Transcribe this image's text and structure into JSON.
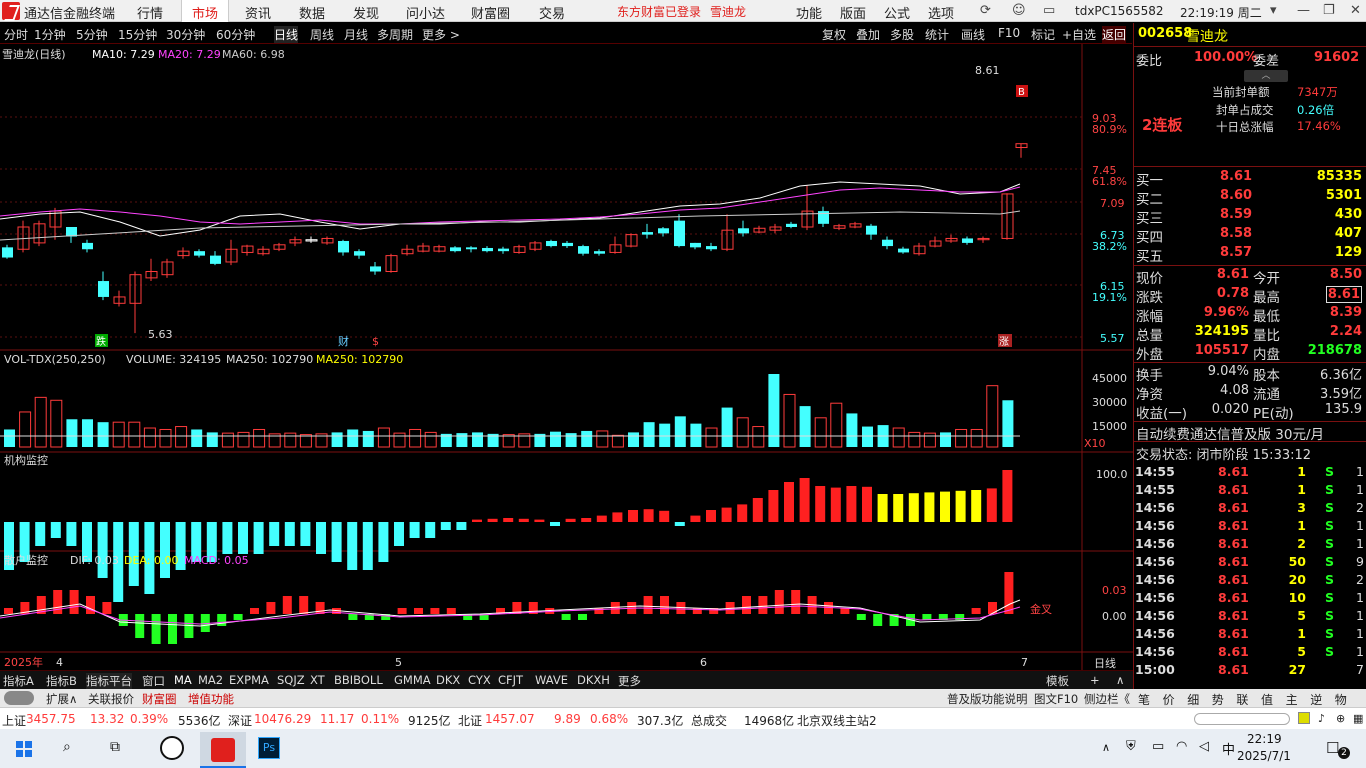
{
  "app": {
    "title": "通达信金融终端"
  },
  "menu": [
    "行情",
    "市场",
    "资讯",
    "数据",
    "发现",
    "问小达",
    "财富圈",
    "交易"
  ],
  "menu_active": 1,
  "login": [
    "东方财富已登录",
    "雪迪龙"
  ],
  "menu_right": [
    "功能",
    "版面",
    "公式",
    "选项"
  ],
  "account": "tdxPC1565582",
  "clock": "22:19:19 周二",
  "periods": [
    "分时",
    "1分钟",
    "5分钟",
    "15分钟",
    "30分钟",
    "60分钟",
    "日线",
    "周线",
    "月线",
    "多周期",
    "更多 >"
  ],
  "period_selected": 6,
  "chart_tools": [
    "复权",
    "叠加",
    "多股",
    "统计",
    "画线",
    "F10",
    "标记",
    "+自选",
    "返回"
  ],
  "kline": {
    "title": "雪迪龙(日线)",
    "ma": [
      {
        "label": "MA10: 7.29",
        "color": "#ffffff"
      },
      {
        "label": "MA20: 7.29",
        "color": "#ff44ff"
      },
      {
        "label": "MA60: 6.98",
        "color": "#dddddd"
      }
    ],
    "price_ticks": [
      "9.03",
      "7.45",
      "7.09",
      "6.73",
      "6.15",
      "5.57"
    ],
    "pct_ticks": [
      "80.9%",
      "61.8%",
      "38.2%",
      "19.1%"
    ],
    "high_label": "8.61",
    "low_label": "5.63",
    "marks": [
      "跌",
      "财",
      "$",
      "涨",
      "B"
    ]
  },
  "volume": {
    "title": "VOL-TDX(250,250)",
    "vol": "VOLUME: 324195",
    "ma": "MA250: 102790",
    "ma2": "MA250: 102790",
    "ticks": [
      "45000",
      "30000",
      "15000"
    ],
    "unit": "X10"
  },
  "inst": {
    "title": "机构监控",
    "ticks": [
      "100.0"
    ]
  },
  "retail": {
    "title": "散户监控",
    "dif": "DIF: 0.03",
    "dea": "DEA: 0.00",
    "macd": "MACD: 0.05",
    "ticks": [
      "0.03",
      "0.00"
    ],
    "cross_label": "金叉"
  },
  "xaxis": {
    "year": "2025年",
    "months": [
      "4",
      "5",
      "6",
      "7"
    ],
    "mode": "日线"
  },
  "chart_data": [
    {
      "type": "bar",
      "title": "雪迪龙(日线)",
      "series": [
        {
          "name": "MA10",
          "value": 7.29
        },
        {
          "name": "MA20",
          "value": 7.29
        },
        {
          "name": "MA60",
          "value": 6.98
        }
      ],
      "ylim": [
        5.57,
        9.03
      ],
      "last_close": 8.61
    },
    {
      "type": "bar",
      "title": "VOL-TDX(250,250)",
      "values": [
        12000,
        24000,
        34000,
        32000,
        19000,
        19000,
        17000,
        17000,
        17000,
        13000,
        12000,
        14000,
        12000,
        10000,
        9500,
        10000,
        12000,
        9000,
        9500,
        8500,
        9000,
        10000,
        12000,
        11000,
        13000,
        9500,
        12000,
        10000,
        9000,
        9500,
        10000,
        9000,
        8500,
        9000,
        9000,
        10500,
        9500,
        11000,
        11000,
        8000,
        10000,
        17000,
        16000,
        21000,
        16000,
        13000,
        27000,
        20000,
        14000,
        50000,
        36000,
        28000,
        20000,
        30000,
        23000,
        14000,
        15000,
        13000,
        10000,
        9500,
        10000,
        12000,
        12000,
        42000,
        32000
      ],
      "ylim": [
        0,
        50000
      ]
    }
  ],
  "stock": {
    "code": "002658",
    "name": "雪迪龙"
  },
  "weibi": {
    "label": "委比",
    "value": "100.00%",
    "label2": "委差",
    "value2": "91602"
  },
  "seal": [
    {
      "k": "当前封单额",
      "v": "7347万"
    },
    {
      "k": "封单占成交",
      "v": "0.26倍"
    },
    {
      "k": "十日总涨幅",
      "v": "17.46%"
    }
  ],
  "lianban": "2连板",
  "bids": [
    {
      "k": "买一",
      "p": "8.61",
      "v": "85335"
    },
    {
      "k": "买二",
      "p": "8.60",
      "v": "5301"
    },
    {
      "k": "买三",
      "p": "8.59",
      "v": "430"
    },
    {
      "k": "买四",
      "p": "8.58",
      "v": "407"
    },
    {
      "k": "买五",
      "p": "8.57",
      "v": "129"
    }
  ],
  "quote": [
    {
      "k1": "现价",
      "v1": "8.61",
      "k2": "今开",
      "v2": "8.50"
    },
    {
      "k1": "涨跌",
      "v1": "0.78",
      "k2": "最高",
      "v2": "8.61"
    },
    {
      "k1": "涨幅",
      "v1": "9.96%",
      "k2": "最低",
      "v2": "8.39"
    },
    {
      "k1": "总量",
      "v1": "324195",
      "k2": "量比",
      "v2": "2.24"
    },
    {
      "k1": "外盘",
      "v1": "105517",
      "k2": "内盘",
      "v2": "218678"
    }
  ],
  "stats": [
    {
      "k1": "换手",
      "v1": "9.04%",
      "k2": "股本",
      "v2": "6.36亿"
    },
    {
      "k1": "净资",
      "v1": "4.08",
      "k2": "流通",
      "v2": "3.59亿"
    },
    {
      "k1": "收益(一)",
      "v1": "0.020",
      "k2": "PE(动)",
      "v2": "135.9"
    }
  ],
  "ad": "自动续费通达信普及版 30元/月",
  "trade_status": "交易状态: 闭市阶段 15:33:12",
  "ticks": [
    {
      "t": "14:55",
      "p": "8.61",
      "v": "1",
      "d": "S",
      "n": "1"
    },
    {
      "t": "14:55",
      "p": "8.61",
      "v": "1",
      "d": "S",
      "n": "1"
    },
    {
      "t": "14:56",
      "p": "8.61",
      "v": "3",
      "d": "S",
      "n": "2"
    },
    {
      "t": "14:56",
      "p": "8.61",
      "v": "1",
      "d": "S",
      "n": "1"
    },
    {
      "t": "14:56",
      "p": "8.61",
      "v": "2",
      "d": "S",
      "n": "1"
    },
    {
      "t": "14:56",
      "p": "8.61",
      "v": "50",
      "d": "S",
      "n": "9"
    },
    {
      "t": "14:56",
      "p": "8.61",
      "v": "20",
      "d": "S",
      "n": "2"
    },
    {
      "t": "14:56",
      "p": "8.61",
      "v": "10",
      "d": "S",
      "n": "1"
    },
    {
      "t": "14:56",
      "p": "8.61",
      "v": "5",
      "d": "S",
      "n": "1"
    },
    {
      "t": "14:56",
      "p": "8.61",
      "v": "1",
      "d": "S",
      "n": "1"
    },
    {
      "t": "14:56",
      "p": "8.61",
      "v": "5",
      "d": "S",
      "n": "1"
    },
    {
      "t": "15:00",
      "p": "8.61",
      "v": "27",
      "d": "",
      "n": "7"
    }
  ],
  "bottom_tabs": [
    "指标A",
    "指标B",
    "指标平台",
    "窗口",
    "MA",
    "MA2",
    "EXPMA",
    "SQJZ",
    "XT",
    "BBIBOLL",
    "GMMA",
    "DKX",
    "CYX",
    "CFJT",
    "WAVE",
    "DKXH",
    "更多"
  ],
  "bottom_right": [
    "模板",
    "+",
    "∧"
  ],
  "func_items": [
    "扩展∧",
    "关联报价",
    "财富圈",
    "增值功能"
  ],
  "func_right": [
    "普及版功能说明",
    "图文F10",
    "侧边栏《"
  ],
  "func_panel": [
    "笔",
    "价",
    "细",
    "势",
    "联",
    "值",
    "主",
    "逆",
    "物"
  ],
  "index_bar": [
    {
      "name": "上证",
      "val": "3457.75",
      "chg": "13.32",
      "pct": "0.39%",
      "amt": "5536亿"
    },
    {
      "name": "深证",
      "val": "10476.29",
      "chg": "11.17",
      "pct": "0.11%",
      "amt": "9125亿"
    },
    {
      "name": "北证",
      "val": "1457.07",
      "chg": "9.89",
      "pct": "0.68%",
      "amt": "307.3亿"
    }
  ],
  "total": {
    "label": "总成交",
    "val": "14968亿"
  },
  "server": "北京双线主站2",
  "taskbar": {
    "time": "22:19",
    "date": "2025/7/1",
    "ime": "中",
    "badge": "2"
  }
}
